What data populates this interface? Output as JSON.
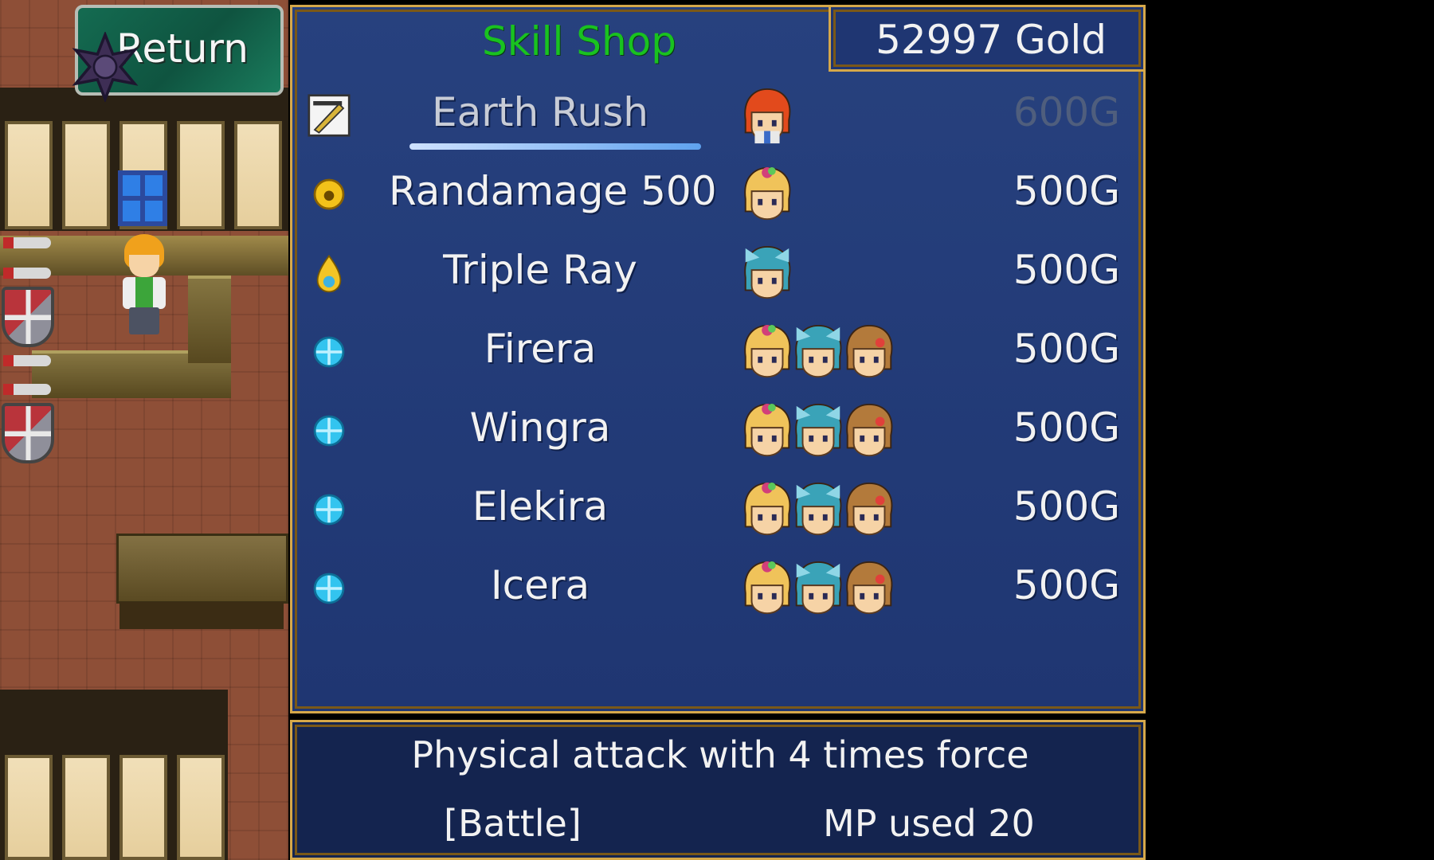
{
  "return_button": {
    "label": "Return",
    "icon": "star-icon"
  },
  "shop": {
    "title": "Skill Shop",
    "gold": "52997 Gold"
  },
  "skills": [
    {
      "name": "Earth Rush",
      "price": "600G",
      "icon": "sword-skill-icon",
      "users": [
        "red-hair-hero"
      ],
      "selected": true,
      "affordable": false
    },
    {
      "name": "Randamage 500",
      "price": "500G",
      "icon": "gold-orb-icon",
      "users": [
        "blonde-girl"
      ],
      "selected": false,
      "affordable": true
    },
    {
      "name": "Triple Ray",
      "price": "500G",
      "icon": "flame-drop-icon",
      "users": [
        "teal-hair-girl"
      ],
      "selected": false,
      "affordable": true
    },
    {
      "name": "Firera",
      "price": "500G",
      "icon": "magic-orb-icon",
      "users": [
        "blonde-girl",
        "teal-hair-girl",
        "brown-hair-girl"
      ],
      "selected": false,
      "affordable": true
    },
    {
      "name": "Wingra",
      "price": "500G",
      "icon": "magic-orb-icon",
      "users": [
        "blonde-girl",
        "teal-hair-girl",
        "brown-hair-girl"
      ],
      "selected": false,
      "affordable": true
    },
    {
      "name": "Elekira",
      "price": "500G",
      "icon": "magic-orb-icon",
      "users": [
        "blonde-girl",
        "teal-hair-girl",
        "brown-hair-girl"
      ],
      "selected": false,
      "affordable": true
    },
    {
      "name": "Icera",
      "price": "500G",
      "icon": "magic-orb-icon",
      "users": [
        "blonde-girl",
        "teal-hair-girl",
        "brown-hair-girl"
      ],
      "selected": false,
      "affordable": true
    }
  ],
  "description": {
    "text": "Physical attack with 4 times force",
    "type": "[Battle]",
    "mp": "MP used 20"
  },
  "colors": {
    "panel_bg": "#22397a",
    "panel_border": "#d6a84a",
    "title": "#19c220",
    "text": "#f2f2f2",
    "disabled_price": "#4f5e7d"
  }
}
